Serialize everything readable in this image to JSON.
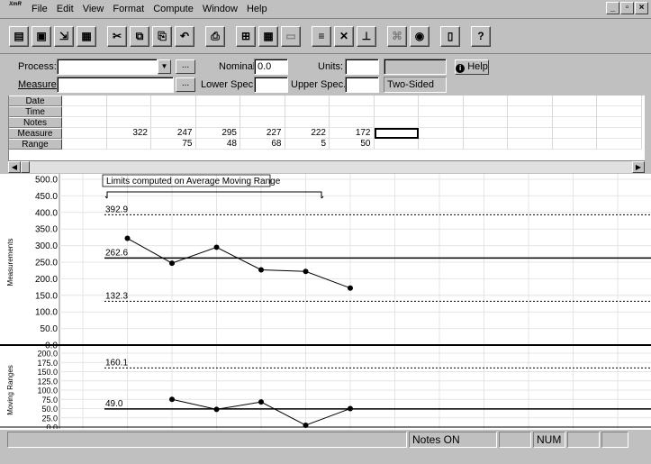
{
  "app": {
    "logo_text": "XmR",
    "window_controls": [
      "_",
      "▫",
      "×"
    ]
  },
  "menu": [
    "File",
    "Edit",
    "View",
    "Format",
    "Compute",
    "Window",
    "Help"
  ],
  "toolbar_icons": [
    "open-data-icon",
    "save-icon",
    "import-icon",
    "new-chart-icon",
    "cut-icon",
    "copy-icon",
    "paste-icon",
    "undo-icon",
    "print-icon",
    "grid-options-icon",
    "calculator-icon",
    "hide-icon",
    "limits-icon",
    "zones-icon",
    "display-icon",
    "tag-icon",
    "page-icon",
    "help-icon"
  ],
  "params": {
    "process_label": "Process:",
    "process_value": "",
    "measure_label": "Measure:",
    "measure_value": "",
    "nominal_label": "Nominal:",
    "nominal_value": "0.0",
    "units_label": "Units:",
    "units_value": "",
    "lower_spec_label": "Lower Spec.:",
    "lower_spec_value": "",
    "upper_spec_label": "Upper Spec.:",
    "upper_spec_value": "",
    "spec_type": "Two-Sided",
    "help_button": "Help",
    "ellipsis": "..."
  },
  "grid": {
    "row_headers": [
      "Date",
      "Time",
      "Notes",
      "Measure",
      "Range"
    ],
    "measure": [
      "",
      "322",
      "247",
      "295",
      "227",
      "222",
      "172",
      "",
      "",
      "",
      "",
      "",
      ""
    ],
    "range": [
      "",
      "",
      "75",
      "48",
      "68",
      "5",
      "50",
      "",
      "",
      "",
      "",
      "",
      ""
    ]
  },
  "chart_data": [
    {
      "type": "line",
      "title": "Limits computed on Average Moving Range",
      "ylabel": "Measurements",
      "ylim": [
        0,
        500
      ],
      "yticks": [
        "500.0",
        "450.0",
        "400.0",
        "350.0",
        "300.0",
        "250.0",
        "200.0",
        "150.0",
        "100.0",
        "50.0",
        "0.0"
      ],
      "x": [
        1,
        2,
        3,
        4,
        5,
        6
      ],
      "values": [
        322,
        247,
        295,
        227,
        222,
        172
      ],
      "center_line": 262.6,
      "upper_limit": 392.9,
      "lower_limit": 132.3,
      "labels": {
        "ucl": "392.9",
        "cl": "262.6",
        "lcl": "132.3"
      }
    },
    {
      "type": "line",
      "ylabel": "Moving Ranges",
      "ylim": [
        0,
        200
      ],
      "yticks": [
        "200.0",
        "175.0",
        "150.0",
        "125.0",
        "100.0",
        "75.0",
        "50.0",
        "25.0",
        "0.0"
      ],
      "x": [
        2,
        3,
        4,
        5,
        6
      ],
      "values": [
        75,
        48,
        68,
        5,
        50
      ],
      "center_line": 49.0,
      "upper_limit": 160.1,
      "labels": {
        "ucl": "160.1",
        "cl": "49.0"
      }
    }
  ],
  "status": {
    "notes": "Notes ON",
    "num": "NUM"
  }
}
